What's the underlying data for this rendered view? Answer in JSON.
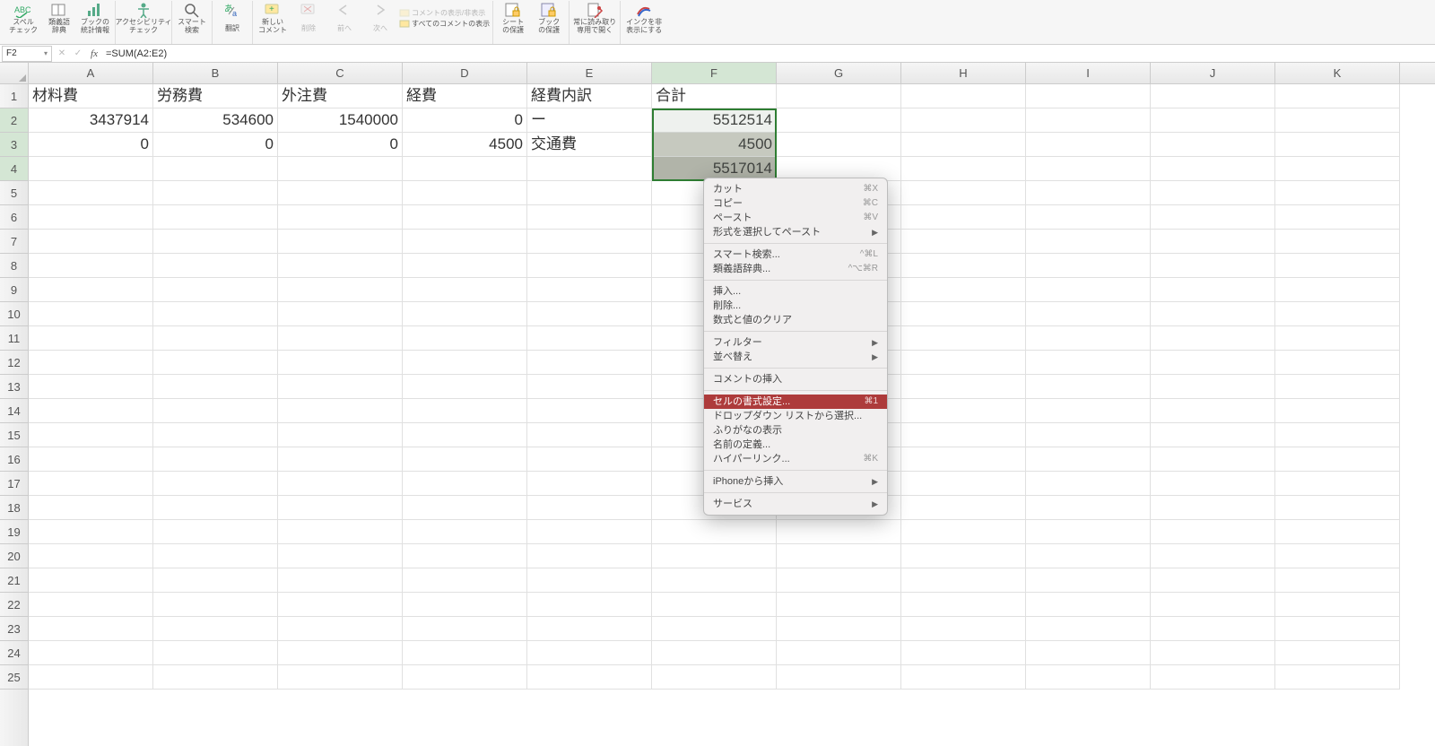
{
  "ribbon": {
    "spell_check": "スペル\nチェック",
    "thesaurus": "類義語\n辞典",
    "book_stats": "ブックの\n統計情報",
    "accessibility": "アクセシビリティ\nチェック",
    "smart_lookup": "スマート\n検索",
    "translate": "翻訳",
    "new_comment": "新しい\nコメント",
    "delete": "削除",
    "prev": "前へ",
    "next": "次へ",
    "show_hide_comment": "コメントの表示/非表示",
    "show_all_comments": "すべてのコメントの表示",
    "protect_sheet": "シート\nの保護",
    "protect_book": "ブック\nの保護",
    "readonly": "常に読み取り\n専用で開く",
    "hide_ink": "インクを非\n表示にする"
  },
  "formula_bar": {
    "cell_ref": "F2",
    "formula": "=SUM(A2:E2)"
  },
  "columns": [
    "A",
    "B",
    "C",
    "D",
    "E",
    "F",
    "G",
    "H",
    "I",
    "J",
    "K"
  ],
  "rows": [
    "1",
    "2",
    "3",
    "4",
    "5",
    "6",
    "7",
    "8",
    "9",
    "10",
    "11",
    "12",
    "13",
    "14",
    "15",
    "16",
    "17",
    "18",
    "19",
    "20",
    "21",
    "22",
    "23",
    "24",
    "25"
  ],
  "headers": {
    "A": "材料費",
    "B": "労務費",
    "C": "外注費",
    "D": "経費",
    "E": "経費内訳",
    "F": "合計"
  },
  "row2": {
    "A": "3437914",
    "B": "534600",
    "C": "1540000",
    "D": "0",
    "E": "ー",
    "F": "5512514"
  },
  "row3": {
    "A": "0",
    "B": "0",
    "C": "0",
    "D": "4500",
    "E": "交通費",
    "F": "4500"
  },
  "row4": {
    "F": "5517014"
  },
  "context_menu": {
    "cut": "カット",
    "cut_k": "⌘X",
    "copy": "コピー",
    "copy_k": "⌘C",
    "paste": "ペースト",
    "paste_k": "⌘V",
    "paste_special": "形式を選択してペースト",
    "smart_lookup": "スマート検索...",
    "smart_k": "^⌘L",
    "thesaurus": "類義語辞典...",
    "thes_k": "^⌥⌘R",
    "insert": "挿入...",
    "delete": "削除...",
    "clear": "数式と値のクリア",
    "filter": "フィルター",
    "sort": "並べ替え",
    "insert_comment": "コメントの挿入",
    "format_cells": "セルの書式設定...",
    "format_k": "⌘1",
    "dropdown": "ドロップダウン リストから選択...",
    "furigana": "ふりがなの表示",
    "define_name": "名前の定義...",
    "hyperlink": "ハイパーリンク...",
    "hyper_k": "⌘K",
    "iphone": "iPhoneから挿入",
    "services": "サービス"
  }
}
